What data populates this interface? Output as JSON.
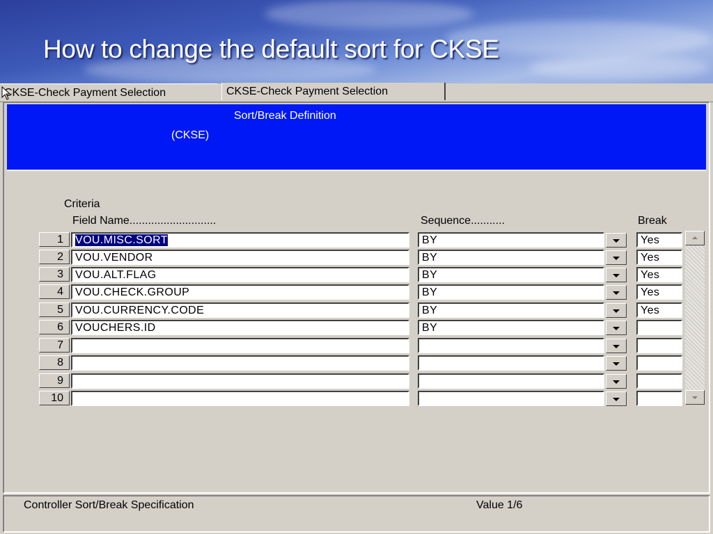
{
  "slide": {
    "title": "How to change the default sort for CKSE"
  },
  "tabs": [
    {
      "label": "CKSE-Check Payment Selection"
    },
    {
      "label": "CKSE-Check Payment Selection"
    }
  ],
  "panel": {
    "title": "Sort/Break Definition",
    "subtitle": "(CKSE)"
  },
  "form": {
    "criteria_label": "Criteria",
    "headers": {
      "field": "Field Name............................",
      "sequence": "Sequence...........",
      "break": "Break"
    },
    "rows": [
      {
        "num": "1",
        "field": "VOU.MISC.SORT",
        "sequence": "BY",
        "break": "Yes",
        "selected": true
      },
      {
        "num": "2",
        "field": "VOU.VENDOR",
        "sequence": "BY",
        "break": "Yes"
      },
      {
        "num": "3",
        "field": "VOU.ALT.FLAG",
        "sequence": "BY",
        "break": "Yes"
      },
      {
        "num": "4",
        "field": "VOU.CHECK.GROUP",
        "sequence": "BY",
        "break": "Yes"
      },
      {
        "num": "5",
        "field": "VOU.CURRENCY.CODE",
        "sequence": "BY",
        "break": "Yes"
      },
      {
        "num": "6",
        "field": "VOUCHERS.ID",
        "sequence": "BY",
        "break": ""
      },
      {
        "num": "7",
        "field": "",
        "sequence": "",
        "break": ""
      },
      {
        "num": "8",
        "field": "",
        "sequence": "",
        "break": ""
      },
      {
        "num": "9",
        "field": "",
        "sequence": "",
        "break": ""
      },
      {
        "num": "10",
        "field": "",
        "sequence": "",
        "break": ""
      }
    ]
  },
  "status": {
    "text": "Controller Sort/Break Specification",
    "value": "Value 1/6"
  },
  "colors": {
    "panel_blue": "#0018f5",
    "window_gray": "#d4d0c8",
    "selection": "#000080"
  }
}
